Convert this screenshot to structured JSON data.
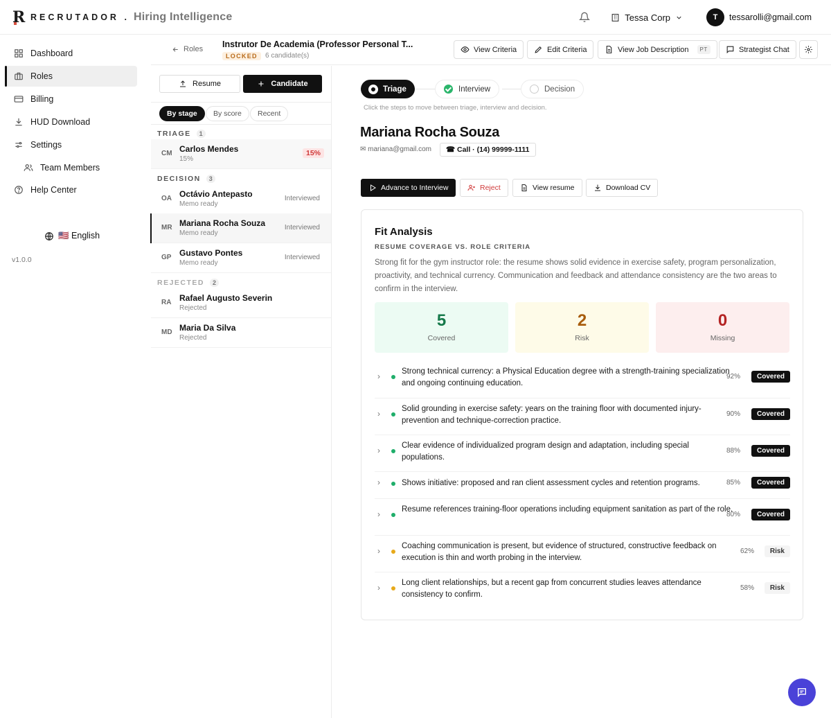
{
  "brand": {
    "name": "RECRUTADOR",
    "dot": ".",
    "subtitle": "Hiring Intelligence"
  },
  "topbar": {
    "company": "Tessa Corp",
    "avatar_initial": "T",
    "user_email": "tessarolli@gmail.com"
  },
  "sidebar": {
    "items": [
      {
        "label": "Dashboard",
        "icon": "dashboard-icon"
      },
      {
        "label": "Roles",
        "icon": "briefcase-icon"
      },
      {
        "label": "Billing",
        "icon": "card-icon"
      },
      {
        "label": "HUD Download",
        "icon": "download-icon"
      },
      {
        "label": "Settings",
        "icon": "sliders-icon"
      },
      {
        "label": "Team Members",
        "icon": "users-icon"
      },
      {
        "label": "Help Center",
        "icon": "help-icon"
      }
    ],
    "language": "🇺🇸 English",
    "version": "v1.0.0"
  },
  "header": {
    "back_label": "Roles",
    "role_title": "Instrutor De Academia (Professor Personal T...",
    "locked_label": "LOCKED",
    "candidate_count": "6 candidate(s)",
    "view_criteria": "View Criteria",
    "edit_criteria": "Edit Criteria",
    "view_job_description": "View Job Description",
    "language_badge": "PT",
    "strategist_chat": "Strategist Chat"
  },
  "list": {
    "resume_button": "Resume",
    "candidate_button": "Candidate",
    "sort_options": [
      "By stage",
      "By score",
      "Recent"
    ],
    "groups": {
      "triage": {
        "label": "TRIAGE",
        "count": "1"
      },
      "decision": {
        "label": "DECISION",
        "count": "3"
      },
      "rejected": {
        "label": "REJECTED",
        "count": "2"
      }
    },
    "triage": [
      {
        "initials": "CM",
        "name": "Carlos Mendes",
        "sub": "15%",
        "badge": "15%"
      }
    ],
    "decision": [
      {
        "initials": "OA",
        "name": "Octávio Antepasto",
        "sub": "Memo ready",
        "status": "Interviewed"
      },
      {
        "initials": "MR",
        "name": "Mariana Rocha Souza",
        "sub": "Memo ready",
        "status": "Interviewed"
      },
      {
        "initials": "GP",
        "name": "Gustavo Pontes",
        "sub": "Memo ready",
        "status": "Interviewed"
      }
    ],
    "rejected": [
      {
        "initials": "RA",
        "name": "Rafael Augusto Severin",
        "sub": "Rejected"
      },
      {
        "initials": "MD",
        "name": "Maria Da Silva",
        "sub": "Rejected"
      }
    ]
  },
  "main": {
    "steps": [
      "Triage",
      "Interview",
      "Decision"
    ],
    "steps_hint": "Click the steps to move between triage, interview and decision.",
    "candidate_name": "Mariana Rocha Souza",
    "email": "✉ mariana@gmail.com",
    "call_label": "☎ Call · (14) 99999-1111",
    "actions": {
      "advance": "Advance to Interview",
      "reject": "Reject",
      "view_resume": "View resume",
      "download_cv": "Download CV"
    },
    "fit": {
      "title": "Fit Analysis",
      "subtitle": "RESUME COVERAGE VS. ROLE CRITERIA",
      "summary": "Strong fit for the gym instructor role: the resume shows solid evidence in exercise safety, program personalization, proactivity, and technical currency. Communication and feedback and attendance consistency are the two areas to confirm in the interview.",
      "stats": [
        {
          "value": "5",
          "label": "Covered"
        },
        {
          "value": "2",
          "label": "Risk"
        },
        {
          "value": "0",
          "label": "Missing"
        }
      ],
      "criteria": [
        {
          "text": "Strong technical currency: a Physical Education degree with a strength-training specialization and ongoing continuing education.",
          "pct": "92%",
          "status": "Covered"
        },
        {
          "text": "Solid grounding in exercise safety: years on the training floor with documented injury-prevention and technique-correction practice.",
          "pct": "90%",
          "status": "Covered"
        },
        {
          "text": "Clear evidence of individualized program design and adaptation, including special populations.",
          "pct": "88%",
          "status": "Covered"
        },
        {
          "text": "Shows initiative: proposed and ran client assessment cycles and retention programs.",
          "pct": "85%",
          "status": "Covered"
        },
        {
          "text": "Resume references training-floor operations including equipment sanitation as part of the role.",
          "pct": "80%",
          "status": "Covered"
        },
        {
          "text": "Coaching communication is present, but evidence of structured, constructive feedback on execution is thin and worth probing in the interview.",
          "pct": "62%",
          "status": "Risk"
        },
        {
          "text": "Long client relationships, but a recent gap from concurrent studies leaves attendance consistency to confirm.",
          "pct": "58%",
          "status": "Risk"
        }
      ]
    }
  },
  "colors": {
    "covered_bg": "#ecfbf3",
    "covered_num": "#16794a",
    "risk_bg": "#fefbe8",
    "risk_num": "#a85d0d",
    "missing_bg": "#fdeeee",
    "missing_num": "#b42323",
    "green_dot": "#1fae6a",
    "amber_dot": "#e7a91a",
    "fab": "#4a42d8"
  }
}
